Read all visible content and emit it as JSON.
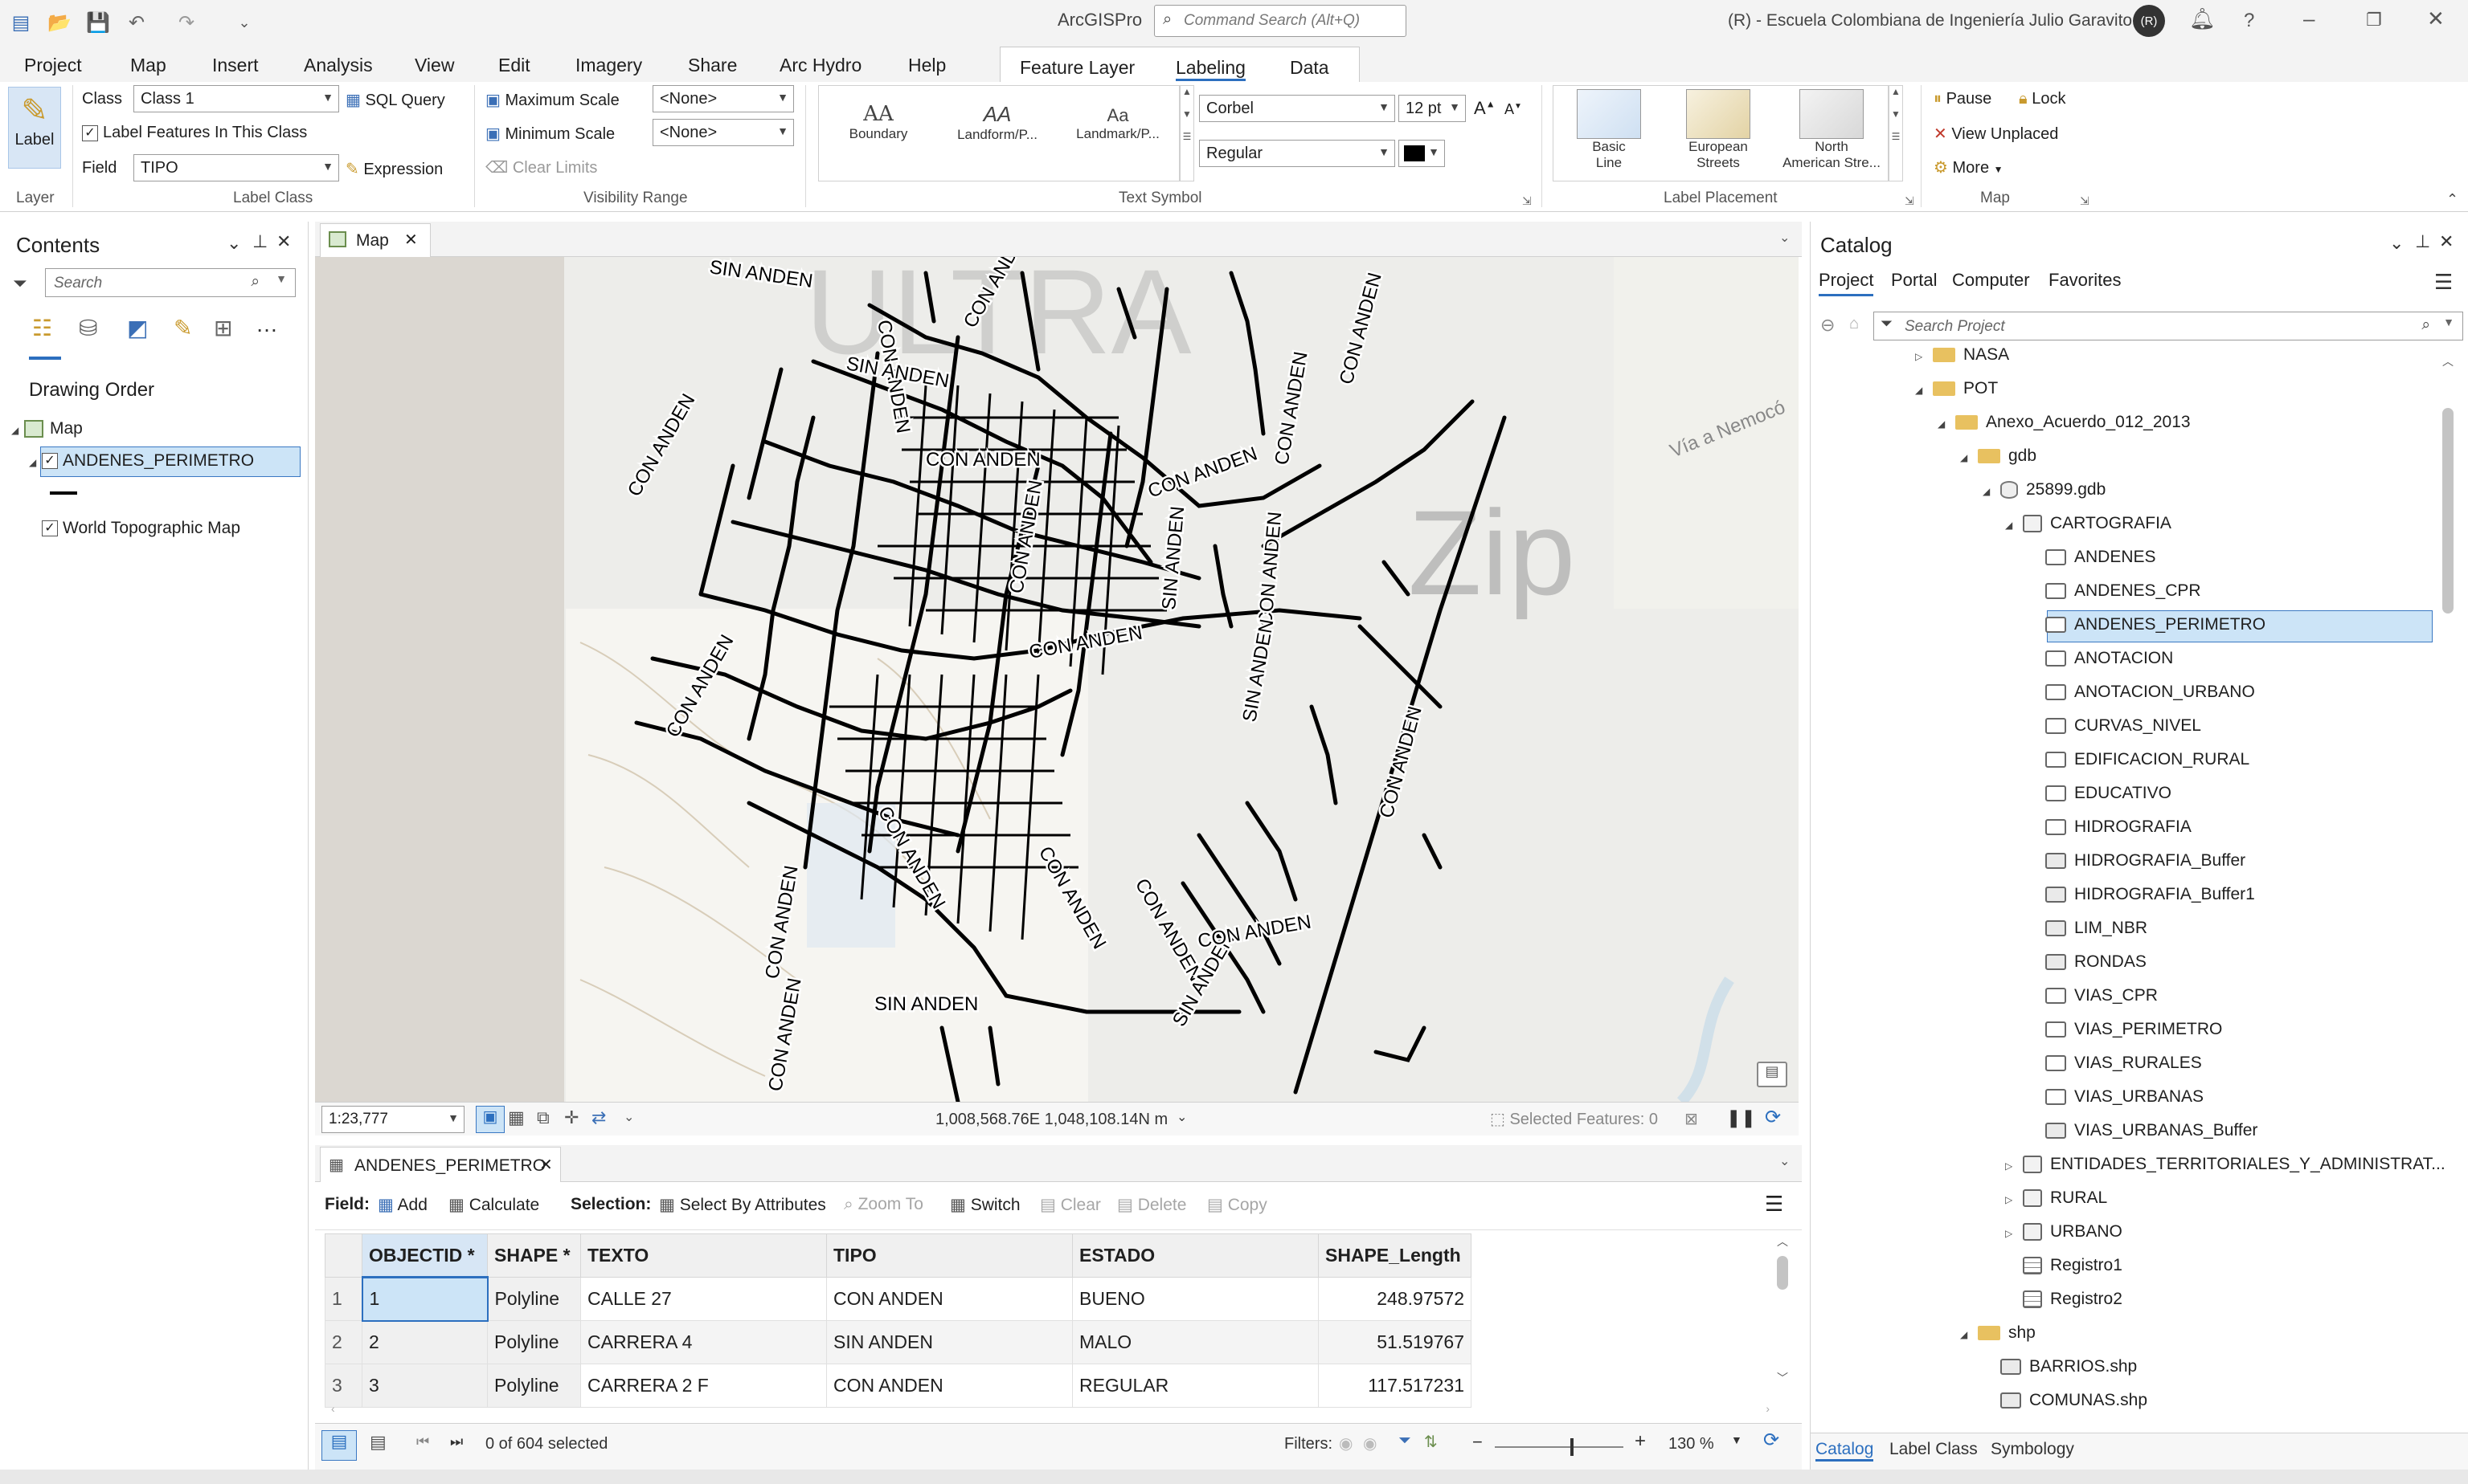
{
  "titlebar": {
    "app_title": "ArcGISPro",
    "command_search_placeholder": "Command Search (Alt+Q)",
    "organization": "(R) - Escuela Colombiana de Ingeniería Julio Garavito",
    "avatar_initials": "(R)"
  },
  "ribbon_tabs": [
    "Project",
    "Map",
    "Insert",
    "Analysis",
    "View",
    "Edit",
    "Imagery",
    "Share",
    "Arc Hydro",
    "Help"
  ],
  "contextual_tabs": [
    "Feature Layer",
    "Labeling",
    "Data"
  ],
  "active_tab": "Labeling",
  "ribbon": {
    "layer_group": {
      "button": "Label",
      "group_label": "Layer"
    },
    "label_class": {
      "class_label": "Class",
      "class_value": "Class 1",
      "sql_query": "SQL Query",
      "label_features_checkbox": "Label Features In This Class",
      "field_label": "Field",
      "field_value": "TIPO",
      "expression": "Expression",
      "group_label": "Label Class"
    },
    "visibility_range": {
      "max_scale": "Maximum Scale",
      "max_value": "<None>",
      "min_scale": "Minimum Scale",
      "min_value": "<None>",
      "clear_limits": "Clear Limits",
      "group_label": "Visibility Range"
    },
    "text_symbol": {
      "gallery": [
        "Boundary",
        "Landform/P...",
        "Landmark/P..."
      ],
      "gallery_glyphs": [
        "AA",
        "AA",
        "Aa"
      ],
      "font": "Corbel",
      "size": "12 pt",
      "style": "Regular",
      "color": "#000000",
      "group_label": "Text Symbol"
    },
    "label_placement": {
      "items": [
        {
          "line1": "Basic",
          "line2": "Line"
        },
        {
          "line1": "European",
          "line2": "Streets"
        },
        {
          "line1": "North",
          "line2": "American Stre..."
        }
      ],
      "group_label": "Label Placement"
    },
    "map_group": {
      "pause": "Pause",
      "lock": "Lock",
      "view_unplaced": "View Unplaced",
      "more": "More",
      "group_label": "Map"
    }
  },
  "contents": {
    "title": "Contents",
    "search_placeholder": "Search",
    "drawing_order": "Drawing Order",
    "items": [
      {
        "label": "Map",
        "checked": null
      },
      {
        "label": "ANDENES_PERIMETRO",
        "checked": true,
        "selected": true
      },
      {
        "label": "World Topographic Map",
        "checked": true
      }
    ]
  },
  "map": {
    "tab_label": "Map",
    "scale": "1:23,777",
    "coordinates": "1,008,568.76E 1,048,108.14N m",
    "selected_features": "Selected Features: 0",
    "basemap_text": [
      "Zip",
      "Vía a Nemocó",
      "ULTRA"
    ],
    "labels": [
      {
        "text": "SIN ANDEN"
      },
      {
        "text": "CON ANDEN"
      },
      {
        "text": "CON ANDEN"
      },
      {
        "text": "CON ANDEN"
      },
      {
        "text": "SIN ANDEN"
      },
      {
        "text": "CON ANDEN"
      },
      {
        "text": "CON ANDEN"
      },
      {
        "text": "CON ANDEN"
      },
      {
        "text": "CON ANDEN"
      },
      {
        "text": "SIN ANDEN"
      },
      {
        "text": "CON ANDEN"
      },
      {
        "text": "CON ANDEN"
      },
      {
        "text": "SIN ANDEN"
      },
      {
        "text": "CON ANDEN"
      },
      {
        "text": "CON ANDEN"
      },
      {
        "text": "CON ANDEN"
      },
      {
        "text": "CON ANDEN"
      },
      {
        "text": "CON ANDEN"
      },
      {
        "text": "SIN ANDEN"
      },
      {
        "text": "CON ANDEN"
      },
      {
        "text": "SIN ANDEN"
      },
      {
        "text": "CON ANDEN"
      },
      {
        "text": "CON ANDEN"
      },
      {
        "text": "CON ANDEN"
      }
    ]
  },
  "attribute_table": {
    "tab_label": "ANDENES_PERIMETRO",
    "toolbar": {
      "field_label": "Field:",
      "add": "Add",
      "calculate": "Calculate",
      "selection_label": "Selection:",
      "select_by_attributes": "Select By Attributes",
      "zoom_to": "Zoom To",
      "switch": "Switch",
      "clear": "Clear",
      "delete": "Delete",
      "copy": "Copy"
    },
    "columns": [
      "OBJECTID *",
      "SHAPE *",
      "TEXTO",
      "TIPO",
      "ESTADO",
      "SHAPE_Length"
    ],
    "rows": [
      {
        "n": "1",
        "cells": [
          "1",
          "Polyline",
          "CALLE 27",
          "CON ANDEN",
          "BUENO",
          "248.97572"
        ]
      },
      {
        "n": "2",
        "cells": [
          "2",
          "Polyline",
          "CARRERA 4",
          "SIN ANDEN",
          "MALO",
          "51.519767"
        ]
      },
      {
        "n": "3",
        "cells": [
          "3",
          "Polyline",
          "CARRERA 2 F",
          "CON ANDEN",
          "REGULAR",
          "117.517231"
        ]
      }
    ],
    "status": "0 of 604 selected",
    "filters_label": "Filters:",
    "zoom": "130 %"
  },
  "catalog": {
    "title": "Catalog",
    "tabs": [
      "Project",
      "Portal",
      "Computer",
      "Favorites"
    ],
    "active_tab": "Project",
    "search_placeholder": "Search Project",
    "tree": [
      {
        "label": "NASA",
        "icon": "folder",
        "level": 1,
        "expander": "collapsed"
      },
      {
        "label": "POT",
        "icon": "folder",
        "level": 1,
        "expander": "expanded"
      },
      {
        "label": "Anexo_Acuerdo_012_2013",
        "icon": "folder",
        "level": 2,
        "expander": "expanded"
      },
      {
        "label": "gdb",
        "icon": "folder",
        "level": 3,
        "expander": "expanded"
      },
      {
        "label": "25899.gdb",
        "icon": "geodatabase",
        "level": 4,
        "expander": "expanded"
      },
      {
        "label": "CARTOGRAFIA",
        "icon": "dataset",
        "level": 5,
        "expander": "expanded"
      },
      {
        "label": "ANDENES",
        "icon": "line-fc",
        "level": 6
      },
      {
        "label": "ANDENES_CPR",
        "icon": "line-fc",
        "level": 6
      },
      {
        "label": "ANDENES_PERIMETRO",
        "icon": "line-fc",
        "level": 6,
        "selected": true
      },
      {
        "label": "ANOTACION",
        "icon": "point-fc",
        "level": 6
      },
      {
        "label": "ANOTACION_URBANO",
        "icon": "point-fc",
        "level": 6
      },
      {
        "label": "CURVAS_NIVEL",
        "icon": "line-fc",
        "level": 6
      },
      {
        "label": "EDIFICACION_RURAL",
        "icon": "point-fc",
        "level": 6
      },
      {
        "label": "EDUCATIVO",
        "icon": "point-fc",
        "level": 6
      },
      {
        "label": "HIDROGRAFIA",
        "icon": "line-fc",
        "level": 6
      },
      {
        "label": "HIDROGRAFIA_Buffer",
        "icon": "polygon-fc",
        "level": 6
      },
      {
        "label": "HIDROGRAFIA_Buffer1",
        "icon": "polygon-fc",
        "level": 6
      },
      {
        "label": "LIM_NBR",
        "icon": "polygon-fc",
        "level": 6
      },
      {
        "label": "RONDAS",
        "icon": "polygon-fc",
        "level": 6
      },
      {
        "label": "VIAS_CPR",
        "icon": "line-fc",
        "level": 6
      },
      {
        "label": "VIAS_PERIMETRO",
        "icon": "line-fc",
        "level": 6
      },
      {
        "label": "VIAS_RURALES",
        "icon": "line-fc",
        "level": 6
      },
      {
        "label": "VIAS_URBANAS",
        "icon": "line-fc",
        "level": 6
      },
      {
        "label": "VIAS_URBANAS_Buffer",
        "icon": "polygon-fc",
        "level": 6
      },
      {
        "label": "ENTIDADES_TERRITORIALES_Y_ADMINISTRAT...",
        "icon": "dataset",
        "level": 5,
        "expander": "collapsed"
      },
      {
        "label": "RURAL",
        "icon": "dataset",
        "level": 5,
        "expander": "collapsed"
      },
      {
        "label": "URBANO",
        "icon": "dataset",
        "level": 5,
        "expander": "collapsed"
      },
      {
        "label": "Registro1",
        "icon": "table",
        "level": 5
      },
      {
        "label": "Registro2",
        "icon": "table",
        "level": 5
      },
      {
        "label": "shp",
        "icon": "folder",
        "level": 3,
        "expander": "expanded"
      },
      {
        "label": "BARRIOS.shp",
        "icon": "polygon-fc",
        "level": 4
      },
      {
        "label": "COMUNAS.shp",
        "icon": "polygon-fc",
        "level": 4
      }
    ],
    "bottom_tabs": [
      "Catalog",
      "Label Class",
      "Symbology"
    ],
    "active_bottom_tab": "Catalog"
  },
  "colors": {
    "accent": "#2c6fbf",
    "selection": "#cce4f7",
    "selection_border": "#3a78c3",
    "folder": "#e8c160"
  }
}
